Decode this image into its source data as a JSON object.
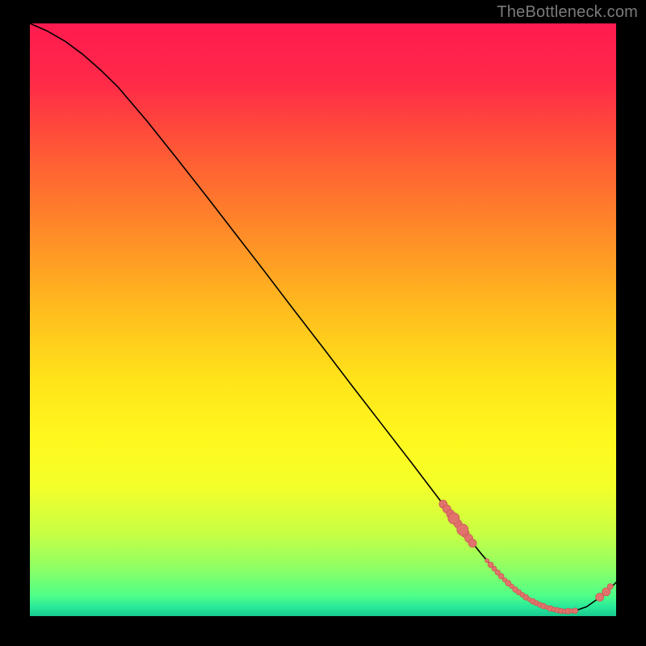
{
  "attribution": "TheBottleneck.com",
  "colors": {
    "gradient_stops": [
      {
        "offset": 0.0,
        "color": "#ff1a4f"
      },
      {
        "offset": 0.1,
        "color": "#ff2a48"
      },
      {
        "offset": 0.22,
        "color": "#ff5a35"
      },
      {
        "offset": 0.35,
        "color": "#ff8a28"
      },
      {
        "offset": 0.48,
        "color": "#ffbb1e"
      },
      {
        "offset": 0.6,
        "color": "#ffe31a"
      },
      {
        "offset": 0.7,
        "color": "#fff81e"
      },
      {
        "offset": 0.78,
        "color": "#f4ff2a"
      },
      {
        "offset": 0.86,
        "color": "#c8ff44"
      },
      {
        "offset": 0.92,
        "color": "#8dff66"
      },
      {
        "offset": 0.965,
        "color": "#4fff88"
      },
      {
        "offset": 0.985,
        "color": "#28e89a"
      },
      {
        "offset": 1.0,
        "color": "#18c98e"
      }
    ],
    "line": "#000000",
    "marker_fill": "#e2736c",
    "marker_stroke": "#c95a55"
  },
  "chart_data": {
    "type": "line",
    "title": "",
    "xlabel": "",
    "ylabel": "",
    "xlim": [
      0,
      100
    ],
    "ylim": [
      0,
      100
    ],
    "series": [
      {
        "name": "curve",
        "x": [
          0,
          3,
          6,
          9,
          12,
          15,
          20,
          25,
          30,
          35,
          40,
          45,
          50,
          55,
          60,
          65,
          70,
          73,
          75,
          77,
          79,
          81,
          83,
          85,
          87,
          89,
          91,
          93,
          95,
          97,
          98.5,
          100
        ],
        "y": [
          100,
          98.7,
          97.0,
          94.8,
          92.2,
          89.3,
          83.5,
          77.3,
          71.0,
          64.6,
          58.2,
          51.7,
          45.3,
          38.8,
          32.4,
          26.0,
          19.5,
          15.6,
          13.0,
          10.5,
          8.2,
          6.1,
          4.3,
          2.9,
          1.9,
          1.2,
          0.8,
          0.9,
          1.6,
          3.0,
          4.2,
          5.7
        ]
      }
    ],
    "markers": {
      "cluster_a": {
        "note": "dotted run along descending segment",
        "x_start": 70.5,
        "x_end": 75.5,
        "count": 9,
        "y_start": 18.9,
        "y_end": 12.3,
        "r": 5
      },
      "cluster_a_big": {
        "note": "two larger dots within cluster_a",
        "points": [
          {
            "x": 72.3,
            "y": 16.5
          },
          {
            "x": 73.8,
            "y": 14.6
          }
        ],
        "r": 7
      },
      "cluster_b": {
        "note": "dense dots along the flat bottom",
        "x_start": 78.0,
        "x_end": 93.0,
        "count": 26,
        "r_min": 2.5,
        "r_max": 3.5
      },
      "cluster_c": {
        "note": "two dots on the rising tail",
        "points": [
          {
            "x": 97.2,
            "y": 3.2
          },
          {
            "x": 98.3,
            "y": 4.1
          }
        ],
        "r": 5
      },
      "cluster_c_top": {
        "note": "small extra dot near top of tail pair",
        "points": [
          {
            "x": 99.0,
            "y": 5.0
          }
        ],
        "r": 3.5
      }
    }
  }
}
